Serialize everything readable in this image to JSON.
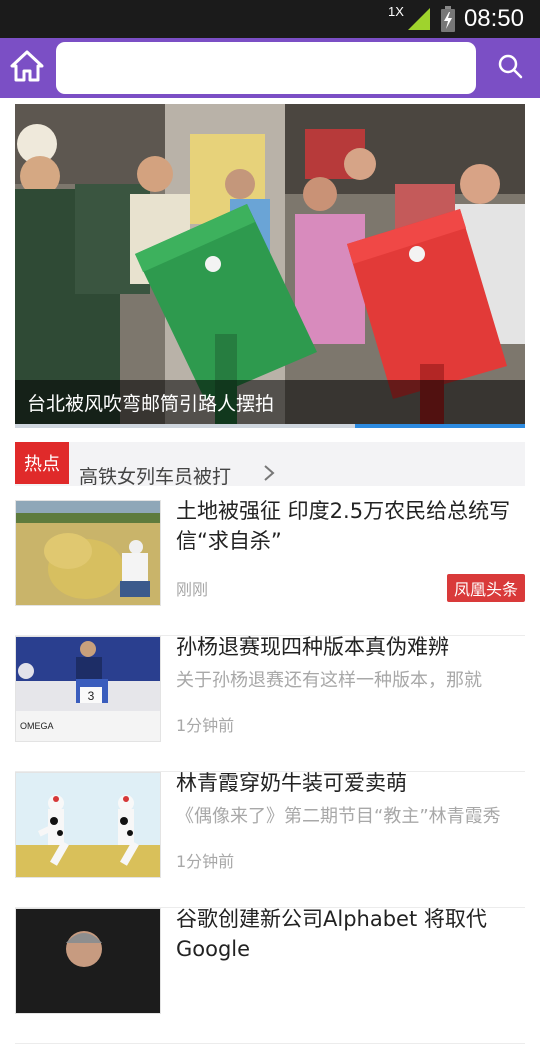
{
  "status_bar": {
    "network_label": "1X",
    "time": "08:50",
    "icons": [
      "signal-icon",
      "battery-charging-icon"
    ]
  },
  "top_bar": {
    "search_value": "",
    "icons": [
      "home-icon",
      "search-icon"
    ],
    "accent_color": "#7b4fc5"
  },
  "hero": {
    "caption": "台北被风吹弯邮筒引路人摆拍",
    "carousel_position": "2 of 3"
  },
  "hot": {
    "badge": "热点",
    "text": "高铁女列车员被打"
  },
  "news": [
    {
      "title": "土地被强征 印度2.5万农民给总统写信“求自杀”",
      "subtitle": "",
      "time": "刚刚",
      "tag": "凤凰头条"
    },
    {
      "title": "孙杨退赛现四种版本真伪难辨",
      "subtitle": "关于孙杨退赛还有这样一种版本，那就",
      "time": "1分钟前",
      "tag": ""
    },
    {
      "title": "林青霞穿奶牛装可爱卖萌",
      "subtitle": "《偶像来了》第二期节目“教主”林青霞秀",
      "time": "1分钟前",
      "tag": ""
    },
    {
      "title": "谷歌创建新公司Alphabet 将取代Google",
      "subtitle": "",
      "time": "",
      "tag": ""
    }
  ],
  "thumb_text": {
    "omega": "OMEGA",
    "lane": "3"
  }
}
